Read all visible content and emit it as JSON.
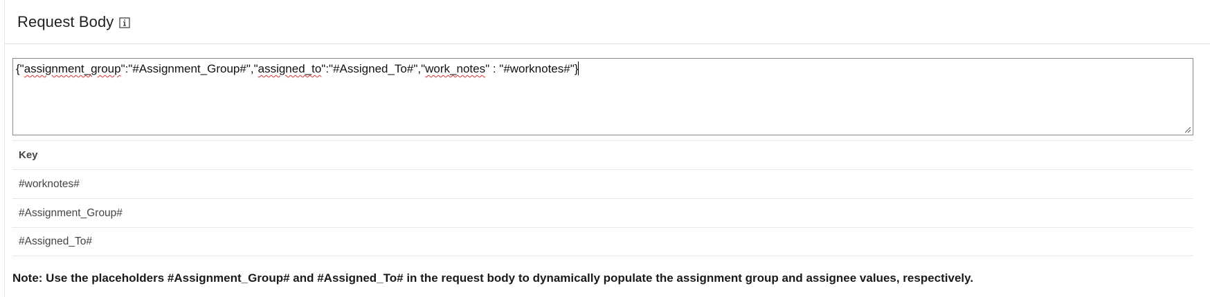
{
  "panel": {
    "title": "Request Body",
    "info_icon": "info-icon"
  },
  "request_body": {
    "segments": [
      {
        "text": "{\"",
        "spell": false
      },
      {
        "text": "assignment_group",
        "spell": true
      },
      {
        "text": "\":\"#Assignment_Group#\",\"",
        "spell": false
      },
      {
        "text": "assigned_to",
        "spell": true
      },
      {
        "text": "\":\"#Assigned_To#\",\"",
        "spell": false
      },
      {
        "text": "work_notes",
        "spell": true
      },
      {
        "text": "\" : \"#worknotes#\"}",
        "spell": false
      }
    ]
  },
  "keys_table": {
    "header": "Key",
    "rows": [
      "#worknotes#",
      "#Assignment_Group#",
      "#Assigned_To#"
    ]
  },
  "note": "Note: Use the placeholders #Assignment_Group# and #Assigned_To# in the request body to dynamically populate the assignment group and assignee values, respectively.",
  "colors": {
    "spellcheck_underline": "#d32f2f",
    "textarea_border": "#8a8a8a",
    "divider": "#e6e6e6"
  }
}
